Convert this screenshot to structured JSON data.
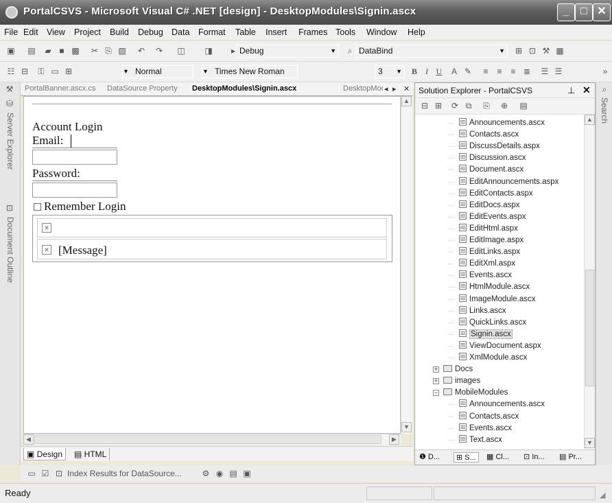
{
  "window": {
    "title": "PortalCSVS - Microsoft Visual C# .NET [design] - DesktopModules\\Signin.ascx"
  },
  "menu": [
    "File",
    "Edit",
    "View",
    "Project",
    "Build",
    "Debug",
    "Data",
    "Format",
    "Table",
    "Insert",
    "Frames",
    "Tools",
    "Window",
    "Help"
  ],
  "toolbar1": {
    "config": "Debug",
    "find": "DataBind"
  },
  "toolbar2": {
    "block_format": "Normal",
    "font_name": "Times New Roman",
    "font_size": "3",
    "bold": "B",
    "italic": "I",
    "underline": "U"
  },
  "doc_tabs": [
    "PortalBanner.ascx.cs",
    "DataSource Property",
    "DesktopModules\\Signin.ascx",
    "DesktopModule"
  ],
  "active_tab_index": 2,
  "left_rail": [
    "Server Explorer",
    "Document Outline"
  ],
  "designer": {
    "heading": "Account Login",
    "email_label": "Email:",
    "password_label": "Password:",
    "remember_label": "Remember Login",
    "message_label": "[Message]"
  },
  "view_tabs": {
    "design": "Design",
    "html": "HTML"
  },
  "pending": {
    "label": "Index Results for DataSource..."
  },
  "status": "Ready",
  "solution_explorer": {
    "title": "Solution Explorer - PortalCSVS",
    "items": [
      {
        "name": "Announcements.ascx",
        "kind": "file",
        "level": 2
      },
      {
        "name": "Contacts.ascx",
        "kind": "file",
        "level": 2
      },
      {
        "name": "DiscussDetails.aspx",
        "kind": "file",
        "level": 2
      },
      {
        "name": "Discussion.ascx",
        "kind": "file",
        "level": 2
      },
      {
        "name": "Document.ascx",
        "kind": "file",
        "level": 2
      },
      {
        "name": "EditAnnouncements.aspx",
        "kind": "file",
        "level": 2
      },
      {
        "name": "EditContacts.aspx",
        "kind": "file",
        "level": 2
      },
      {
        "name": "EditDocs.aspx",
        "kind": "file",
        "level": 2
      },
      {
        "name": "EditEvents.aspx",
        "kind": "file",
        "level": 2
      },
      {
        "name": "EditHtml.aspx",
        "kind": "file",
        "level": 2
      },
      {
        "name": "EditImage.aspx",
        "kind": "file",
        "level": 2
      },
      {
        "name": "EditLinks.aspx",
        "kind": "file",
        "level": 2
      },
      {
        "name": "EditXml.aspx",
        "kind": "file",
        "level": 2
      },
      {
        "name": "Events.ascx",
        "kind": "file",
        "level": 2
      },
      {
        "name": "HtmlModule.ascx",
        "kind": "file",
        "level": 2
      },
      {
        "name": "ImageModule.ascx",
        "kind": "file",
        "level": 2
      },
      {
        "name": "Links.ascx",
        "kind": "file",
        "level": 2
      },
      {
        "name": "QuickLinks.ascx",
        "kind": "file",
        "level": 2
      },
      {
        "name": "Signin.ascx",
        "kind": "file",
        "level": 2,
        "selected": true
      },
      {
        "name": "ViewDocument.aspx",
        "kind": "file",
        "level": 2
      },
      {
        "name": "XmlModule.ascx",
        "kind": "file",
        "level": 2
      },
      {
        "name": "Docs",
        "kind": "folder",
        "level": 1,
        "expander": "+"
      },
      {
        "name": "images",
        "kind": "folder",
        "level": 1,
        "expander": "+"
      },
      {
        "name": "MobileModules",
        "kind": "folder",
        "level": 1,
        "expander": "-"
      },
      {
        "name": "Announcements.ascx",
        "kind": "file",
        "level": 2
      },
      {
        "name": "Contacts.ascx",
        "kind": "file",
        "level": 2
      },
      {
        "name": "Events.ascx",
        "kind": "file",
        "level": 2
      },
      {
        "name": "Text.ascx",
        "kind": "file",
        "level": 2
      }
    ],
    "bottom_tabs": [
      "D...",
      "S...",
      "Cl...",
      "In...",
      "Pr..."
    ]
  },
  "right_rail": [
    "Search"
  ]
}
